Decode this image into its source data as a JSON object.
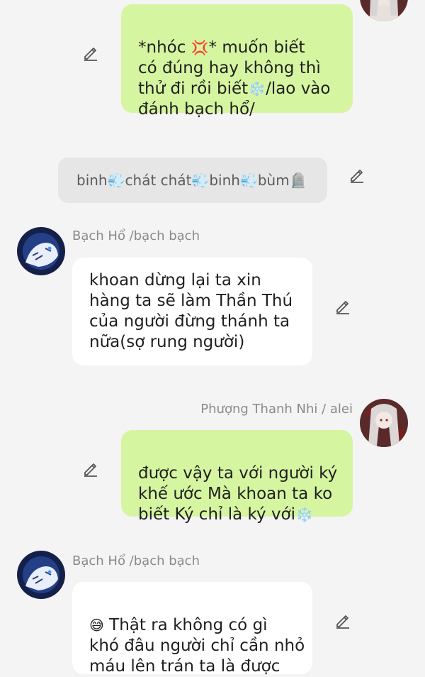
{
  "messages": [
    {
      "id": "m1",
      "side": "right",
      "text_line1_a": "*nhóc ",
      "emoji_anger": "💢",
      "text_line1_b": "* muốn biết",
      "text_line2": "có đúng hay không thì",
      "text_line3_a": "thử đi rồi biết",
      "emoji_snow": "❄️",
      "text_line3_b": "/lao vào",
      "text_line4": "đánh bạch hổ/"
    },
    {
      "id": "sys1",
      "parts": [
        "binh ",
        "💨",
        "chát chát ",
        "💨",
        "binh",
        "💨",
        "bùm",
        "🪦"
      ]
    },
    {
      "id": "m2",
      "side": "left",
      "sender": "Bạch Hổ /bạch bạch",
      "text": "khoan dừng lại ta xin\nhàng ta sẽ làm Thần Thú\ncủa người đừng thánh ta\nnữa(sợ rung người)"
    },
    {
      "id": "m3",
      "side": "right",
      "sender": "Phượng Thanh Nhi / alei",
      "text_line1": "được vậy ta với người ký",
      "text_line2": "khế ước Mà khoan ta ko",
      "text_line3_a": "biết Ký chỉ là ký với",
      "emoji_snow": "❄️"
    },
    {
      "id": "m4",
      "side": "left",
      "sender": "Bạch Hổ /bạch bạch",
      "emoji": "😅",
      "text_line1": " Thật ra không có gì",
      "text_line2": "khó đâu người chỉ cần nhỏ",
      "text_line3": "máu lên trán ta là được"
    }
  ],
  "colors": {
    "outgoing_bubble": "#d6f5a0",
    "incoming_bubble": "#ffffff",
    "system_bubble": "#e6e6e6",
    "background": "#f4f4f4"
  },
  "icons": {
    "edit": "pencil-icon",
    "avatar_tiger": "tiger-avatar",
    "avatar_girl": "girl-avatar"
  }
}
